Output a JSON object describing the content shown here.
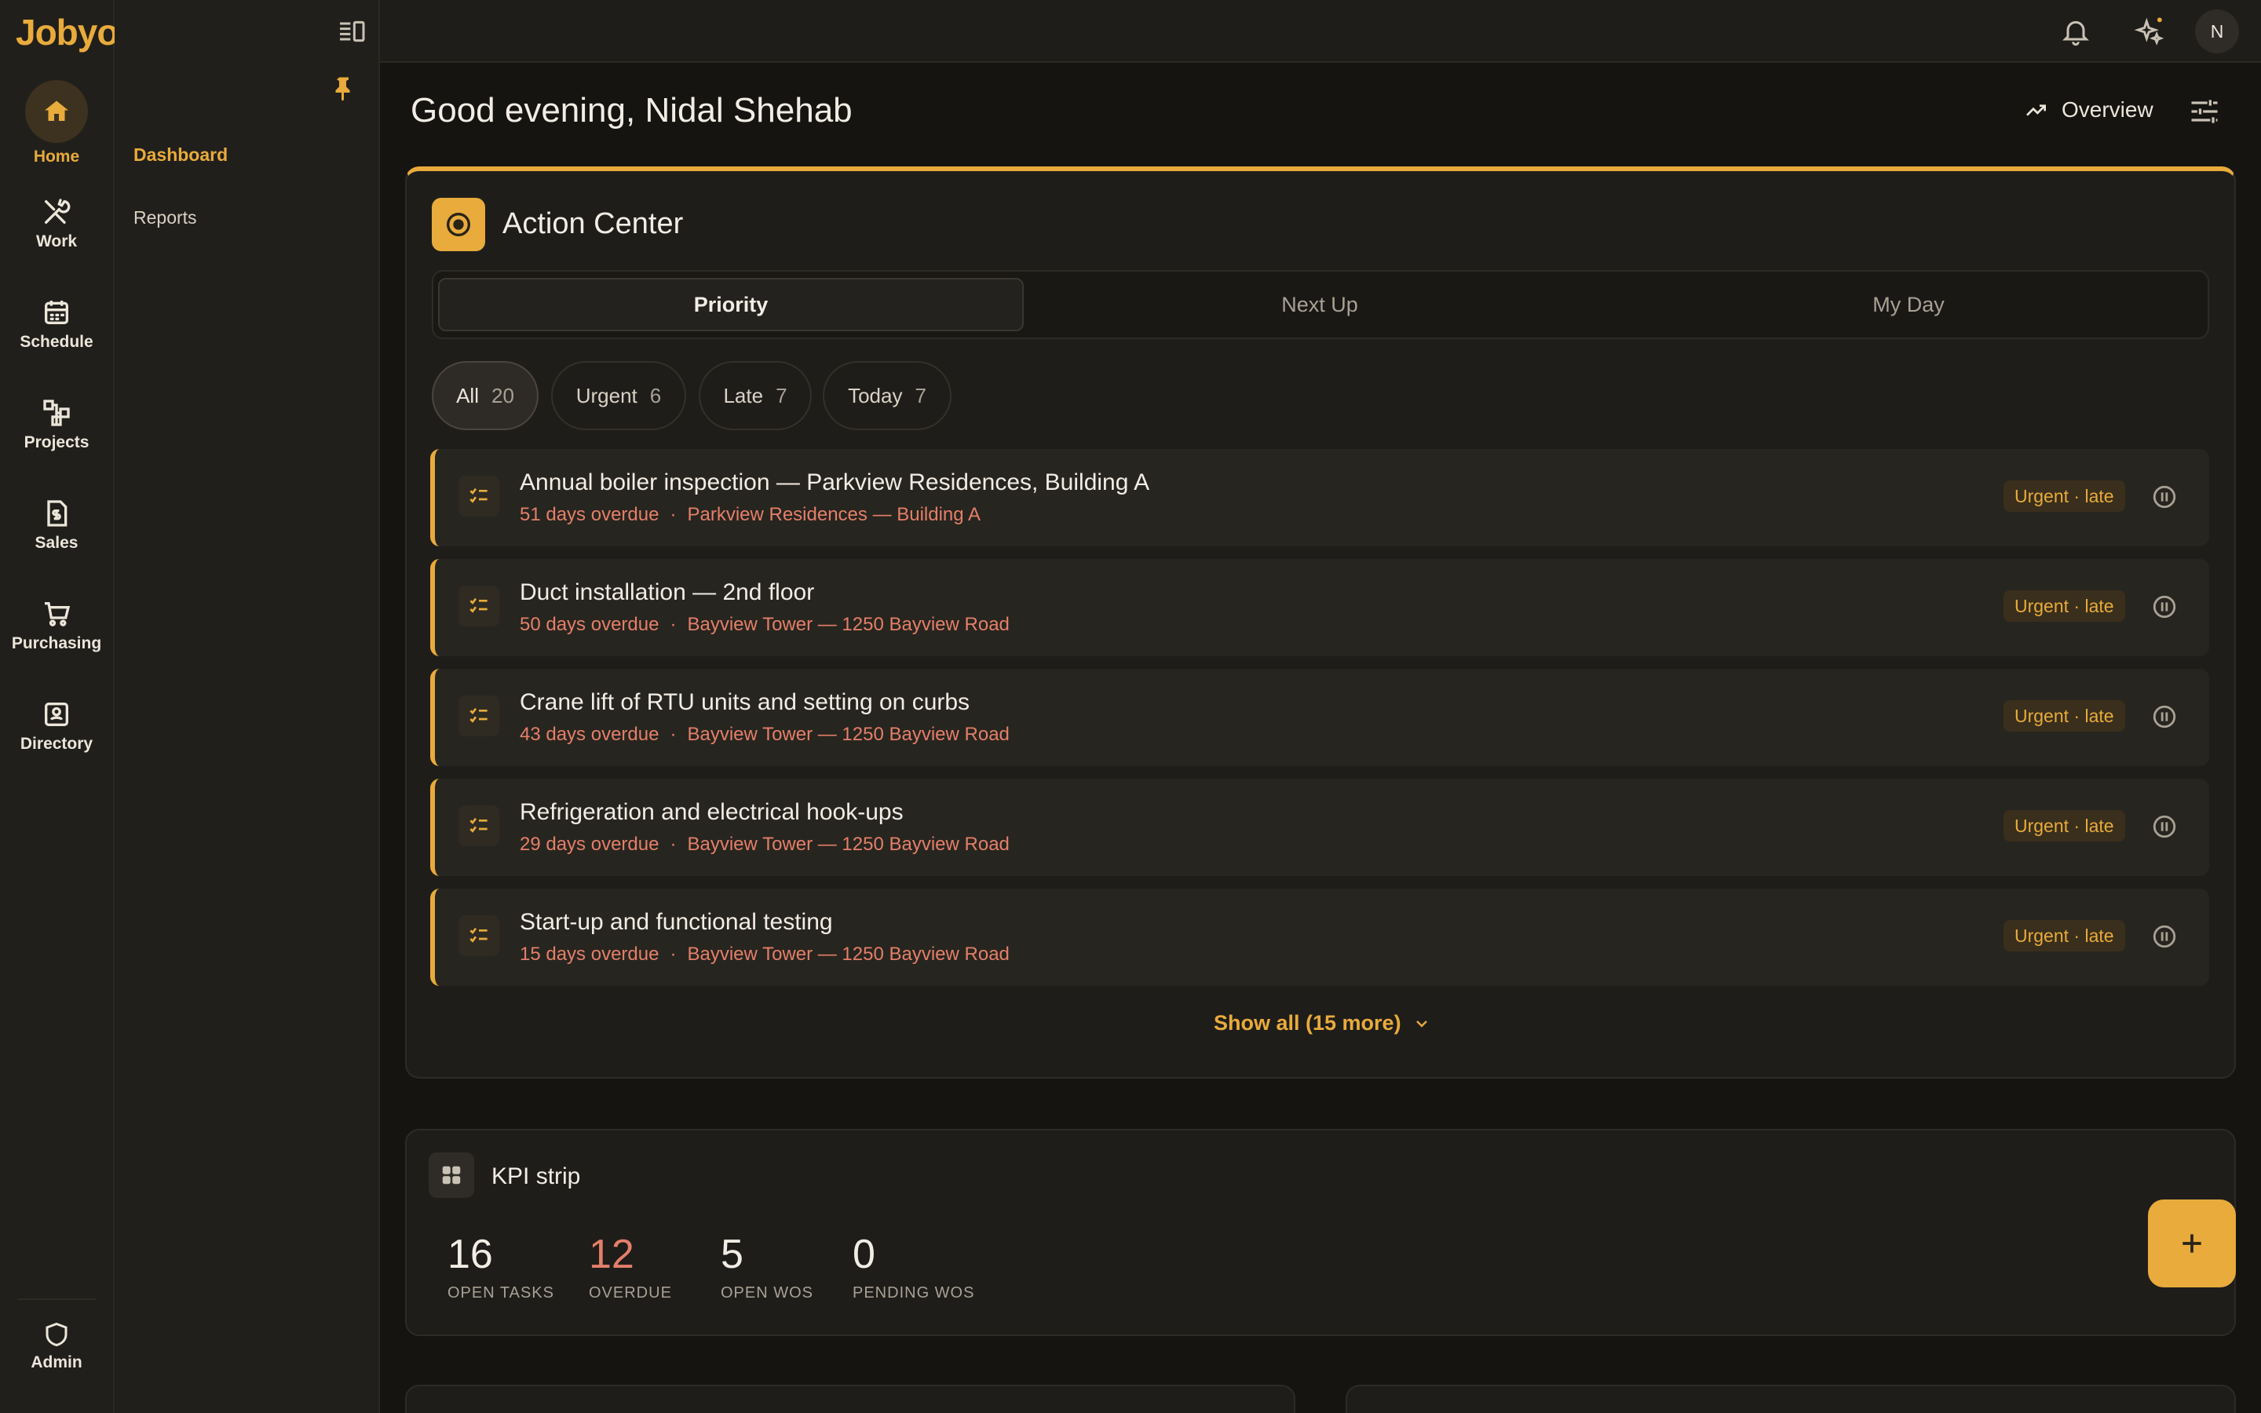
{
  "app": {
    "brand": "Jobyo"
  },
  "rail": {
    "items": [
      {
        "label": "Home",
        "icon": "home-icon"
      },
      {
        "label": "Work",
        "icon": "tools-icon"
      },
      {
        "label": "Schedule",
        "icon": "calendar-icon"
      },
      {
        "label": "Projects",
        "icon": "projects-icon"
      },
      {
        "label": "Sales",
        "icon": "invoice-icon"
      },
      {
        "label": "Purchasing",
        "icon": "cart-icon"
      },
      {
        "label": "Directory",
        "icon": "contacts-icon"
      }
    ],
    "admin": {
      "label": "Admin",
      "icon": "shield-icon"
    }
  },
  "subnav": {
    "items": [
      "Dashboard",
      "Reports"
    ]
  },
  "topbar": {
    "avatar_initial": "N"
  },
  "header": {
    "greeting": "Good evening, Nidal Shehab",
    "overview_label": "Overview"
  },
  "action_center": {
    "title": "Action Center",
    "tabs": [
      "Priority",
      "Next Up",
      "My Day"
    ],
    "filters": [
      {
        "label": "All",
        "count": "20"
      },
      {
        "label": "Urgent",
        "count": "6"
      },
      {
        "label": "Late",
        "count": "7"
      },
      {
        "label": "Today",
        "count": "7"
      }
    ],
    "tasks": [
      {
        "title": "Annual boiler inspection — Parkview Residences, Building A",
        "overdue": "51 days overdue",
        "location": "Parkview Residences — Building A",
        "badge": "Urgent · late"
      },
      {
        "title": "Duct installation — 2nd floor",
        "overdue": "50 days overdue",
        "location": "Bayview Tower — 1250 Bayview Road",
        "badge": "Urgent · late"
      },
      {
        "title": "Crane lift of RTU units and setting on curbs",
        "overdue": "43 days overdue",
        "location": "Bayview Tower — 1250 Bayview Road",
        "badge": "Urgent · late"
      },
      {
        "title": "Refrigeration and electrical hook-ups",
        "overdue": "29 days overdue",
        "location": "Bayview Tower — 1250 Bayview Road",
        "badge": "Urgent · late"
      },
      {
        "title": "Start-up and functional testing",
        "overdue": "15 days overdue",
        "location": "Bayview Tower — 1250 Bayview Road",
        "badge": "Urgent · late"
      }
    ],
    "separator": "·",
    "show_all": "Show all (15 more)"
  },
  "kpi": {
    "title": "KPI strip",
    "items": [
      {
        "value": "16",
        "label": "OPEN TASKS"
      },
      {
        "value": "12",
        "label": "OVERDUE"
      },
      {
        "value": "5",
        "label": "OPEN WOS"
      },
      {
        "value": "0",
        "label": "PENDING WOS"
      }
    ]
  },
  "colors": {
    "accent": "#e8ab3c",
    "overdue": "#e47f6a",
    "background": "#151411"
  }
}
